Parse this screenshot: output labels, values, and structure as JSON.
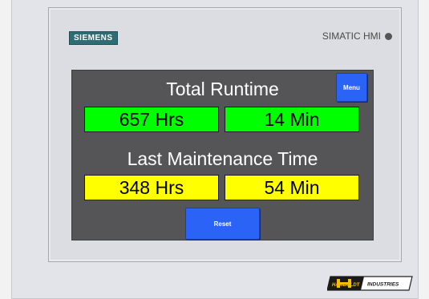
{
  "device": {
    "brand": "SIEMENS",
    "model": "SIMATIC HMI",
    "status_led_icon": "status-led-icon"
  },
  "screen": {
    "menu_button": "Menu",
    "reset_button": "Reset",
    "total_runtime": {
      "heading": "Total Runtime",
      "hours": "657 Hrs",
      "minutes": "14 Min",
      "color": "#00ff00"
    },
    "last_maintenance": {
      "heading": "Last Maintenance Time",
      "hours": "348 Hrs",
      "minutes": "54 Min",
      "color": "#ffff00"
    },
    "background_color": "#555557",
    "button_color": "#2a63f6"
  },
  "footer": {
    "company_logo_text": "HAMBOLDT INDUSTRIES"
  }
}
